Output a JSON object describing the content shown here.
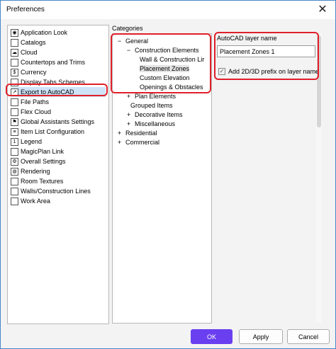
{
  "window": {
    "title": "Preferences",
    "close_glyph": "✕"
  },
  "nav": {
    "items": [
      {
        "label": "Application Look",
        "icon": "eye-icon",
        "glyph": "◉"
      },
      {
        "label": "Catalogs",
        "icon": "catalog-icon",
        "glyph": ""
      },
      {
        "label": "Cloud",
        "icon": "cloud-icon",
        "glyph": "☁"
      },
      {
        "label": "Countertops and Trims",
        "icon": "countertop-icon",
        "glyph": ""
      },
      {
        "label": "Currency",
        "icon": "currency-icon",
        "glyph": "$"
      },
      {
        "label": "Display Tabs Schemes",
        "icon": "tabs-icon",
        "glyph": ""
      },
      {
        "label": "Export to AutoCAD",
        "icon": "export-icon",
        "glyph": "↗"
      },
      {
        "label": "File Paths",
        "icon": "file-icon",
        "glyph": ""
      },
      {
        "label": "Flex Cloud",
        "icon": "flex-cloud-icon",
        "glyph": ""
      },
      {
        "label": "Global Assistants Settings",
        "icon": "flag-icon",
        "glyph": "⚑"
      },
      {
        "label": "Item List Configuration",
        "icon": "list-icon",
        "glyph": "≡"
      },
      {
        "label": "Legend",
        "icon": "legend-icon",
        "glyph": "1"
      },
      {
        "label": "MagicPlan Link",
        "icon": "magicplan-icon",
        "glyph": ""
      },
      {
        "label": "Overall Settings",
        "icon": "settings-icon",
        "glyph": "⚙"
      },
      {
        "label": "Rendering",
        "icon": "rendering-icon",
        "glyph": "◍"
      },
      {
        "label": "Room Textures",
        "icon": "texture-icon",
        "glyph": ""
      },
      {
        "label": "Walls/Construction Lines",
        "icon": "wall-icon",
        "glyph": ""
      },
      {
        "label": "Work Area",
        "icon": "work-area-icon",
        "glyph": ""
      }
    ],
    "selected_index": 6
  },
  "categories": {
    "label": "Categories",
    "tree": [
      {
        "label": "General",
        "toggle": "−",
        "level": 0
      },
      {
        "label": "Construction Elements",
        "toggle": "−",
        "level": 1
      },
      {
        "label": "Wall & Construction Lir",
        "toggle": "",
        "level": 2
      },
      {
        "label": "Placement Zones",
        "toggle": "",
        "level": 2,
        "selected": true
      },
      {
        "label": "Custom Elevation",
        "toggle": "",
        "level": 2
      },
      {
        "label": "Openings & Obstacles",
        "toggle": "",
        "level": 2
      },
      {
        "label": "Plan Elements",
        "toggle": "+",
        "level": 1
      },
      {
        "label": "Grouped Items",
        "toggle": "",
        "level": 1
      },
      {
        "label": "Decorative Items",
        "toggle": "+",
        "level": 1
      },
      {
        "label": "Miscellaneous",
        "toggle": "+",
        "level": 1
      },
      {
        "label": "Residential",
        "toggle": "+",
        "level": 0
      },
      {
        "label": "Commercial",
        "toggle": "+",
        "level": 0
      }
    ]
  },
  "settings": {
    "layer_label": "AutoCAD layer name",
    "layer_value": "Placement Zones 1",
    "prefix_label": "Add 2D/3D prefix on layer name",
    "prefix_checked": true,
    "check_glyph": "✓"
  },
  "buttons": {
    "ok": "OK",
    "apply": "Apply",
    "cancel": "Cancel"
  },
  "colors": {
    "highlight": "#e0202a",
    "ok_button": "#6a3ff0",
    "selection": "#cfe3f7"
  }
}
